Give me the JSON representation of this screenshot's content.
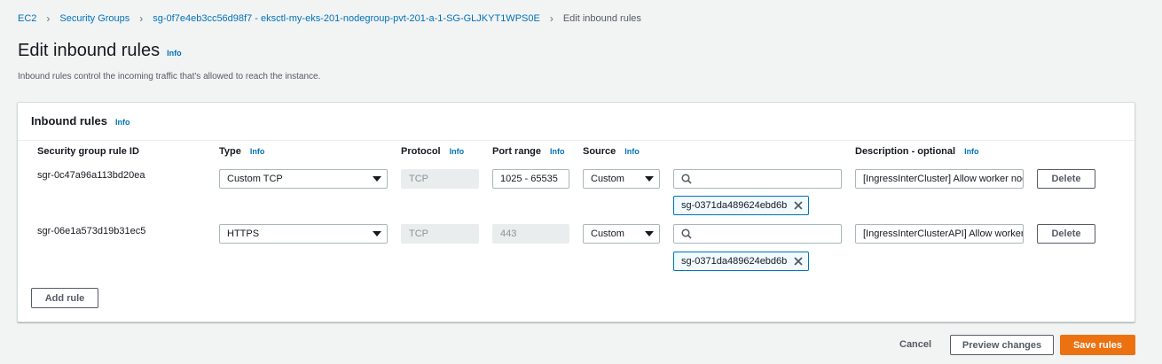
{
  "breadcrumb": {
    "items": [
      "EC2",
      "Security Groups",
      "sg-0f7e4eb3cc56d98f7 - eksctl-my-eks-201-nodegroup-pvt-201-a-1-SG-GLJKYT1WPS0E"
    ],
    "current": "Edit inbound rules"
  },
  "page": {
    "title": "Edit inbound rules",
    "info": "Info",
    "description": "Inbound rules control the incoming traffic that's allowed to reach the instance."
  },
  "panel": {
    "title": "Inbound rules",
    "info": "Info",
    "columns": {
      "rule_id": "Security group rule ID",
      "type": "Type",
      "protocol": "Protocol",
      "port_range": "Port range",
      "source": "Source",
      "description": "Description - optional",
      "info": "Info"
    },
    "rows": [
      {
        "rule_id": "sgr-0c47a96a113bd20ea",
        "type": "Custom TCP",
        "protocol": "TCP",
        "port_range": "1025 - 65535",
        "source": "Custom",
        "search_value": "",
        "token": "sg-0371da489624ebd6b",
        "description": "[IngressInterCluster] Allow worker nodes",
        "delete": "Delete"
      },
      {
        "rule_id": "sgr-06e1a573d19b31ec5",
        "type": "HTTPS",
        "protocol": "TCP",
        "port_range": "443",
        "source": "Custom",
        "search_value": "",
        "token": "sg-0371da489624ebd6b",
        "description": "[IngressInterClusterAPI] Allow worker nodes",
        "delete": "Delete"
      }
    ],
    "add_rule": "Add rule"
  },
  "footer": {
    "cancel": "Cancel",
    "preview": "Preview changes",
    "save": "Save rules"
  },
  "icons": {
    "search": "search-icon",
    "remove": "close-icon",
    "chevron": "chevron-right-icon",
    "dropdown": "caret-down-icon"
  },
  "colors": {
    "link": "#0073bb",
    "primary": "#ec7211",
    "background": "#f2f3f3"
  }
}
